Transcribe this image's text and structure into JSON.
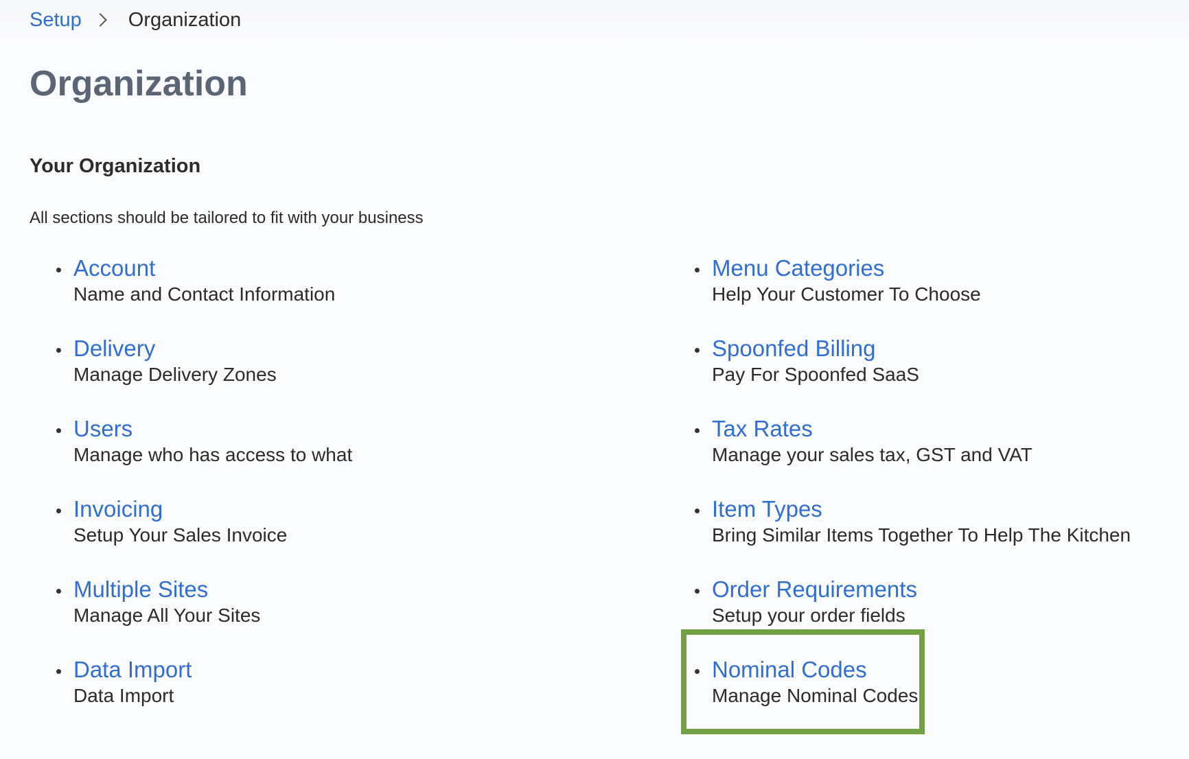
{
  "breadcrumb": {
    "parent": "Setup",
    "current": "Organization"
  },
  "page": {
    "title": "Organization",
    "section_title": "Your Organization",
    "section_description": "All sections should be tailored to fit with your business"
  },
  "left_items": [
    {
      "label": "Account",
      "description": "Name and Contact Information"
    },
    {
      "label": "Delivery",
      "description": "Manage Delivery Zones"
    },
    {
      "label": "Users",
      "description": "Manage who has access to what"
    },
    {
      "label": "Invoicing",
      "description": "Setup Your Sales Invoice"
    },
    {
      "label": "Multiple Sites",
      "description": "Manage All Your Sites"
    },
    {
      "label": "Data Import",
      "description": "Data Import"
    }
  ],
  "right_items": [
    {
      "label": "Menu Categories",
      "description": "Help Your Customer To Choose"
    },
    {
      "label": "Spoonfed Billing",
      "description": "Pay For Spoonfed SaaS"
    },
    {
      "label": "Tax Rates",
      "description": "Manage your sales tax, GST and VAT"
    },
    {
      "label": "Item Types",
      "description": "Bring Similar Items Together To Help The Kitchen"
    },
    {
      "label": "Order Requirements",
      "description": "Setup your order fields"
    },
    {
      "label": "Nominal Codes",
      "description": "Manage Nominal Codes"
    }
  ],
  "colors": {
    "link": "#2f6fd3",
    "title": "#5a6675",
    "highlight": "#73a045"
  },
  "icons": {
    "breadcrumb_separator": "chevron-right-icon",
    "list_bullet": "bullet-icon"
  }
}
